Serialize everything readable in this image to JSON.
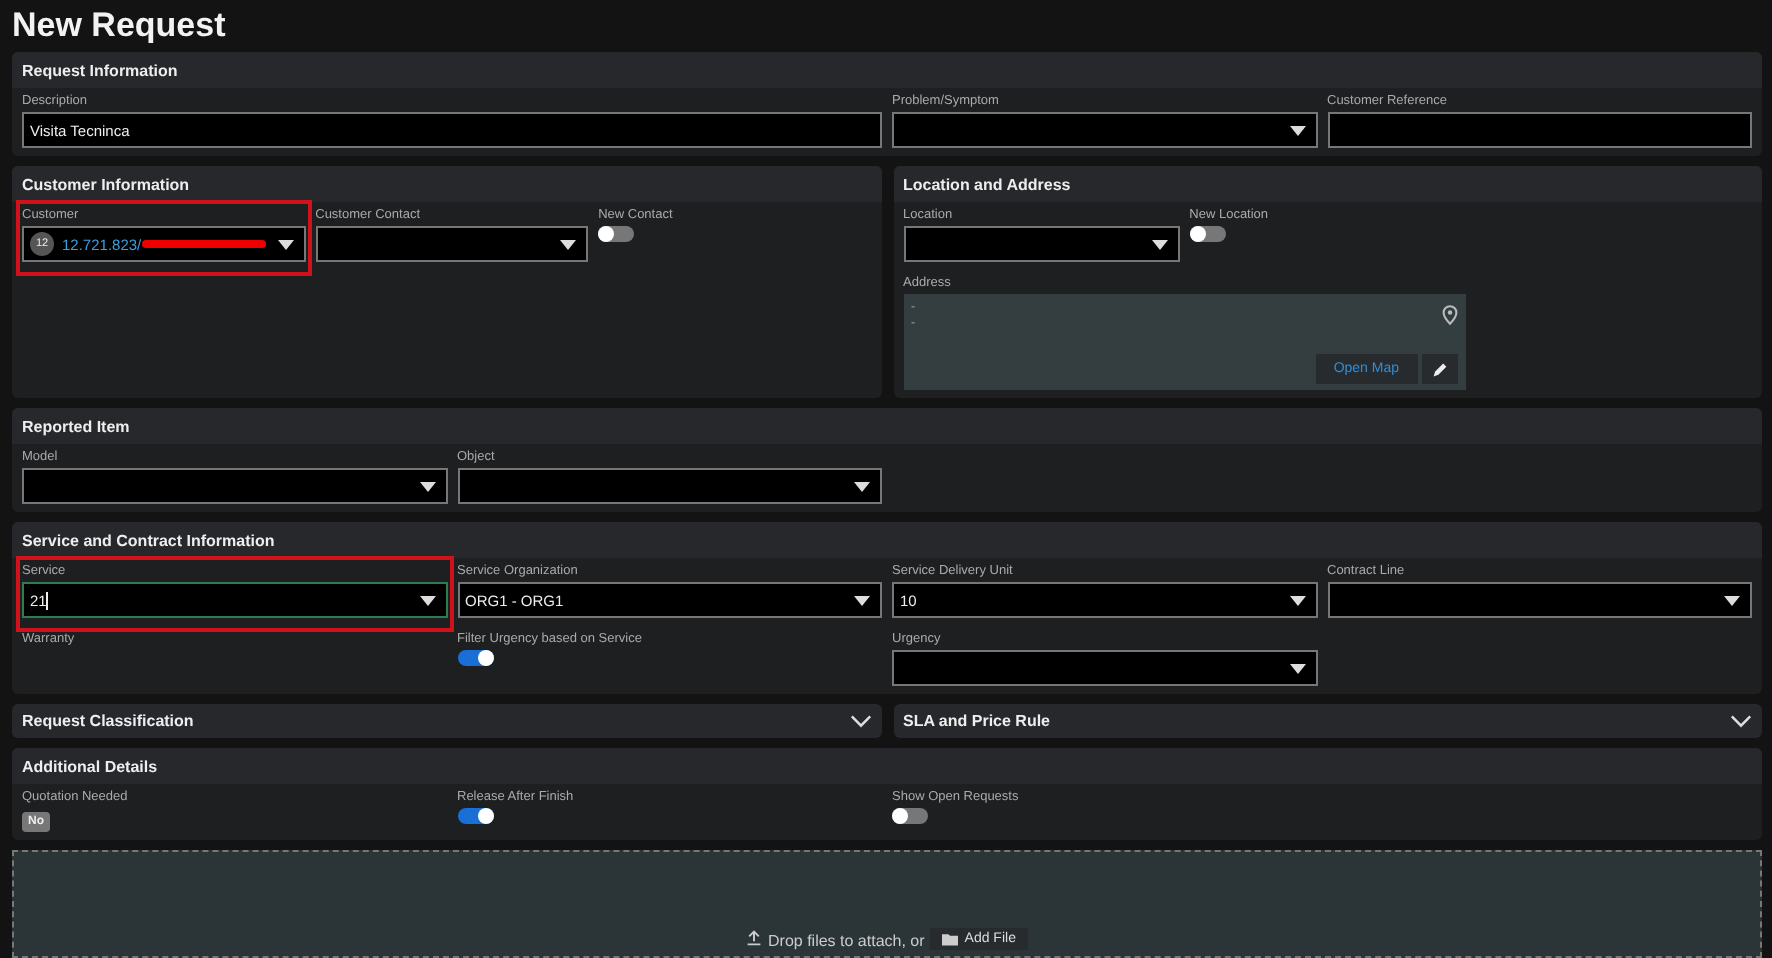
{
  "title": "New Request",
  "blocks": [
    {
      "kind": "section",
      "title": "Request Information",
      "fields": [
        {
          "kind": "text",
          "label": "Description",
          "value": "Visita Tecninca"
        },
        {
          "kind": "select",
          "label": "Problem/Symptom"
        },
        {
          "kind": "text",
          "label": "Customer Reference"
        }
      ]
    },
    {
      "kind": "pair",
      "sections": [
        {
          "title": "Customer Information",
          "fields": [
            {
              "kind": "select",
              "label": "Customer",
              "value": "12.721.823/",
              "avatar": "12",
              "redacted": true,
              "highlighted": true,
              "focused": false
            },
            {
              "kind": "select",
              "label": "Customer Contact"
            },
            {
              "kind": "toggle",
              "label": "New Contact",
              "on": false
            }
          ]
        },
        {
          "title": "Location and Address",
          "fields": [
            {
              "kind": "select",
              "label": "Location"
            },
            {
              "kind": "toggle",
              "label": "New Location",
              "on": false
            },
            {
              "kind": "address",
              "label": "Address",
              "lines": [
                "-",
                "-"
              ],
              "button": "Open Map"
            }
          ]
        }
      ]
    },
    {
      "kind": "section",
      "title": "Reported Item",
      "fields": [
        {
          "kind": "select",
          "label": "Model"
        },
        {
          "kind": "select",
          "label": "Object"
        }
      ]
    },
    {
      "kind": "section",
      "title": "Service and Contract Information",
      "fields": [
        {
          "kind": "select",
          "label": "Service",
          "value": "21",
          "highlighted": true,
          "focused": true
        },
        {
          "kind": "select",
          "label": "Service Organization",
          "value": "ORG1 - ORG1"
        },
        {
          "kind": "select",
          "label": "Service Delivery Unit",
          "value": "10"
        },
        {
          "kind": "select",
          "label": "Contract Line"
        },
        {
          "kind": "label",
          "label": "Warranty"
        },
        {
          "kind": "toggle",
          "label": "Filter Urgency based on Service",
          "on": true
        },
        {
          "kind": "select",
          "label": "Urgency"
        }
      ]
    },
    {
      "kind": "pair",
      "sections": [
        {
          "title": "Request Classification",
          "expanded": false
        },
        {
          "title": "SLA and Price Rule",
          "expanded": false
        }
      ]
    },
    {
      "kind": "section",
      "title": "Additional Details",
      "fields": [
        {
          "kind": "badge",
          "label": "Quotation Needed",
          "value": "No"
        },
        {
          "kind": "toggle",
          "label": "Release After Finish",
          "on": true
        },
        {
          "kind": "toggle",
          "label": "Show Open Requests",
          "on": false
        }
      ]
    }
  ],
  "dropzone": {
    "text": "Drop files to attach, or",
    "button": "Add File"
  }
}
